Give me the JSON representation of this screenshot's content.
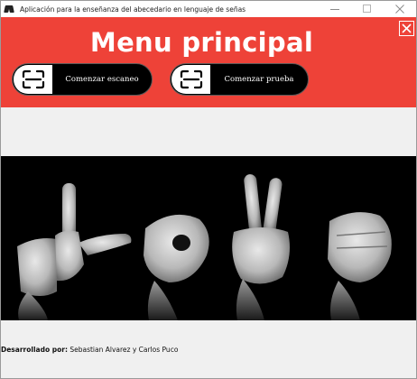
{
  "window": {
    "title": "Aplicación para la enseñanza del abecedario en lenguaje de señas"
  },
  "header": {
    "title": "Menu principal",
    "color": "#ee4238"
  },
  "buttons": {
    "scan_label": "Comenzar escaneo",
    "scan_icon": "scan-frame-icon",
    "test_label": "Comenzar prueba",
    "test_icon": "scan-frame-icon"
  },
  "image": {
    "description_icon": "sign-language-hands-image"
  },
  "footer": {
    "label": "Desarrollado por:",
    "authors": "Sebastian Alvarez y Carlos Puco"
  }
}
